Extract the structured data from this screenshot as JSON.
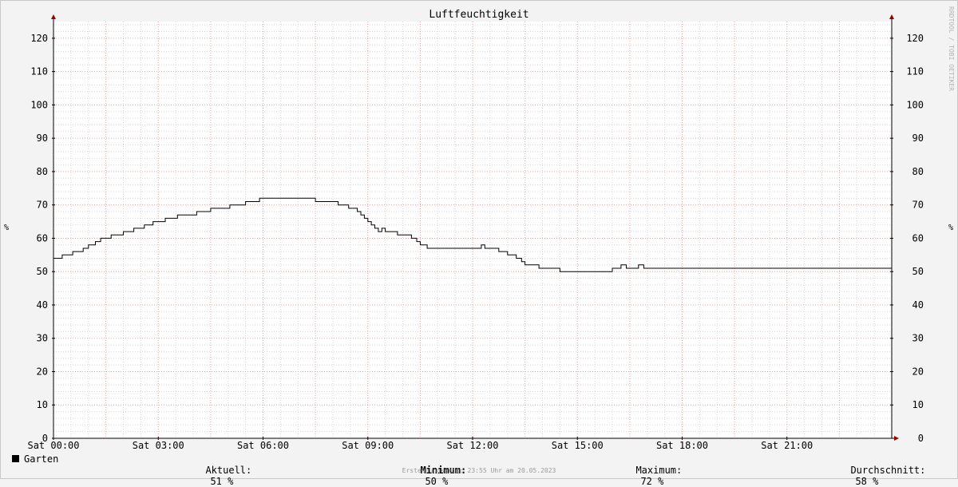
{
  "chart_data": {
    "type": "line",
    "title": "Luftfeuchtigkeit",
    "ylabel": "%",
    "watermark": "RRDTOOL / TOBI OETIKER",
    "ylim": [
      0,
      125
    ],
    "xlim": [
      0,
      24
    ],
    "yticks": [
      0,
      10,
      20,
      30,
      40,
      50,
      60,
      70,
      80,
      90,
      100,
      110,
      120
    ],
    "xticks": [
      {
        "value": 0,
        "label": "Sat 00:00"
      },
      {
        "value": 3,
        "label": "Sat 03:00"
      },
      {
        "value": 6,
        "label": "Sat 06:00"
      },
      {
        "value": 9,
        "label": "Sat 09:00"
      },
      {
        "value": 12,
        "label": "Sat 12:00"
      },
      {
        "value": 15,
        "label": "Sat 15:00"
      },
      {
        "value": 18,
        "label": "Sat 18:00"
      },
      {
        "value": 21,
        "label": "Sat 21:00"
      }
    ],
    "series": [
      {
        "name": "Garten",
        "color": "#000000",
        "points": [
          [
            0.0,
            54
          ],
          [
            0.25,
            55
          ],
          [
            0.55,
            56
          ],
          [
            0.85,
            57
          ],
          [
            1.0,
            58
          ],
          [
            1.2,
            59
          ],
          [
            1.35,
            60
          ],
          [
            1.65,
            61
          ],
          [
            2.0,
            62
          ],
          [
            2.3,
            63
          ],
          [
            2.6,
            64
          ],
          [
            2.85,
            65
          ],
          [
            3.2,
            66
          ],
          [
            3.55,
            67
          ],
          [
            4.1,
            68
          ],
          [
            4.5,
            69
          ],
          [
            5.05,
            70
          ],
          [
            5.5,
            71
          ],
          [
            5.9,
            72
          ],
          [
            7.5,
            71
          ],
          [
            8.15,
            70
          ],
          [
            8.45,
            69
          ],
          [
            8.7,
            68
          ],
          [
            8.8,
            67
          ],
          [
            8.9,
            66
          ],
          [
            9.0,
            65
          ],
          [
            9.1,
            64
          ],
          [
            9.2,
            63
          ],
          [
            9.3,
            62
          ],
          [
            9.4,
            63
          ],
          [
            9.5,
            62
          ],
          [
            9.85,
            61
          ],
          [
            10.25,
            60
          ],
          [
            10.4,
            59
          ],
          [
            10.5,
            58
          ],
          [
            10.7,
            57
          ],
          [
            12.25,
            58
          ],
          [
            12.35,
            57
          ],
          [
            12.75,
            56
          ],
          [
            13.0,
            55
          ],
          [
            13.25,
            54
          ],
          [
            13.4,
            53
          ],
          [
            13.5,
            52
          ],
          [
            13.9,
            51
          ],
          [
            14.5,
            50
          ],
          [
            16.0,
            51
          ],
          [
            16.25,
            52
          ],
          [
            16.4,
            51
          ],
          [
            16.75,
            52
          ],
          [
            16.9,
            51
          ],
          [
            24.0,
            51
          ]
        ]
      }
    ],
    "legend": {
      "label": "Garten",
      "color": "#000000"
    },
    "stats": {
      "current_label": "Aktuell:",
      "current_value": "51 %",
      "min_label": "Minimum:",
      "min_value": "50 %",
      "max_label": "Maximum:",
      "max_value": "72 %",
      "avg_label": "Durchschnitt:",
      "avg_value": "58 %"
    },
    "footer": "Erstellungszeit: 23:55 Uhr am 20.05.2023",
    "colors": {
      "background": "#f3f3f3",
      "plot": "#ffffff",
      "major_grid": "#f2a0a0",
      "minor_grid": "#d8d8d8",
      "axis": "#000000",
      "arrow": "#9b0000"
    }
  }
}
